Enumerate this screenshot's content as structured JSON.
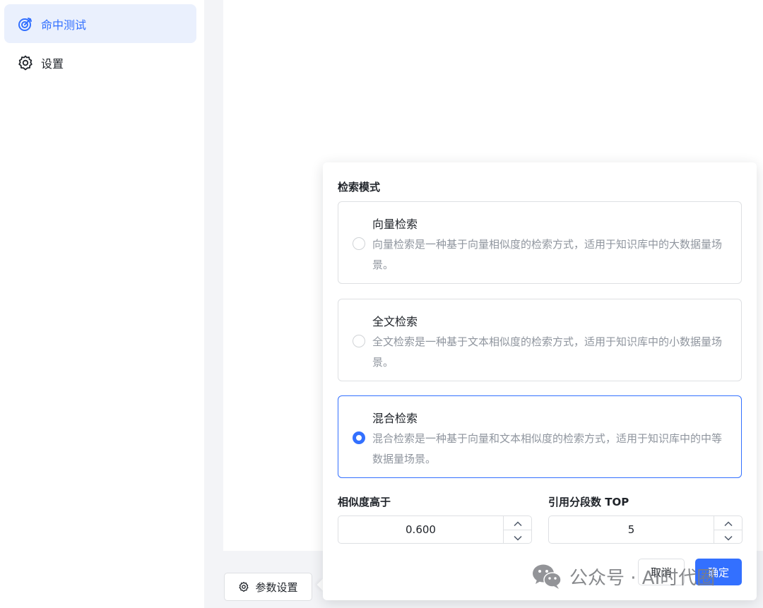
{
  "sidebar": {
    "items": [
      {
        "label": "命中测试",
        "icon": "target-icon",
        "active": true
      },
      {
        "label": "设置",
        "icon": "gear-icon",
        "active": false
      }
    ]
  },
  "toolbar": {
    "param_settings_label": "参数设置"
  },
  "popover": {
    "section_title": "检索模式",
    "modes": [
      {
        "title": "向量检索",
        "desc": "向量检索是一种基于向量相似度的检索方式，适用于知识库中的大数据量场景。",
        "selected": false
      },
      {
        "title": "全文检索",
        "desc": "全文检索是一种基于文本相似度的检索方式，适用于知识库中的小数据量场景。",
        "selected": false
      },
      {
        "title": "混合检索",
        "desc": "混合检索是一种基于向量和文本相似度的检索方式，适用于知识库中的中等数据量场景。",
        "selected": true
      }
    ],
    "similarity": {
      "label": "相似度高于",
      "value": "0.600"
    },
    "top_n": {
      "label": "引用分段数 TOP",
      "value": "5"
    },
    "cancel_label": "取消",
    "confirm_label": "确定"
  },
  "watermark": {
    "text": "公众号 · AI时代圈"
  },
  "colors": {
    "accent": "#3370ff",
    "active_bg": "#eaf0fd",
    "muted_text": "#8f959e",
    "border": "#dee0e3"
  }
}
